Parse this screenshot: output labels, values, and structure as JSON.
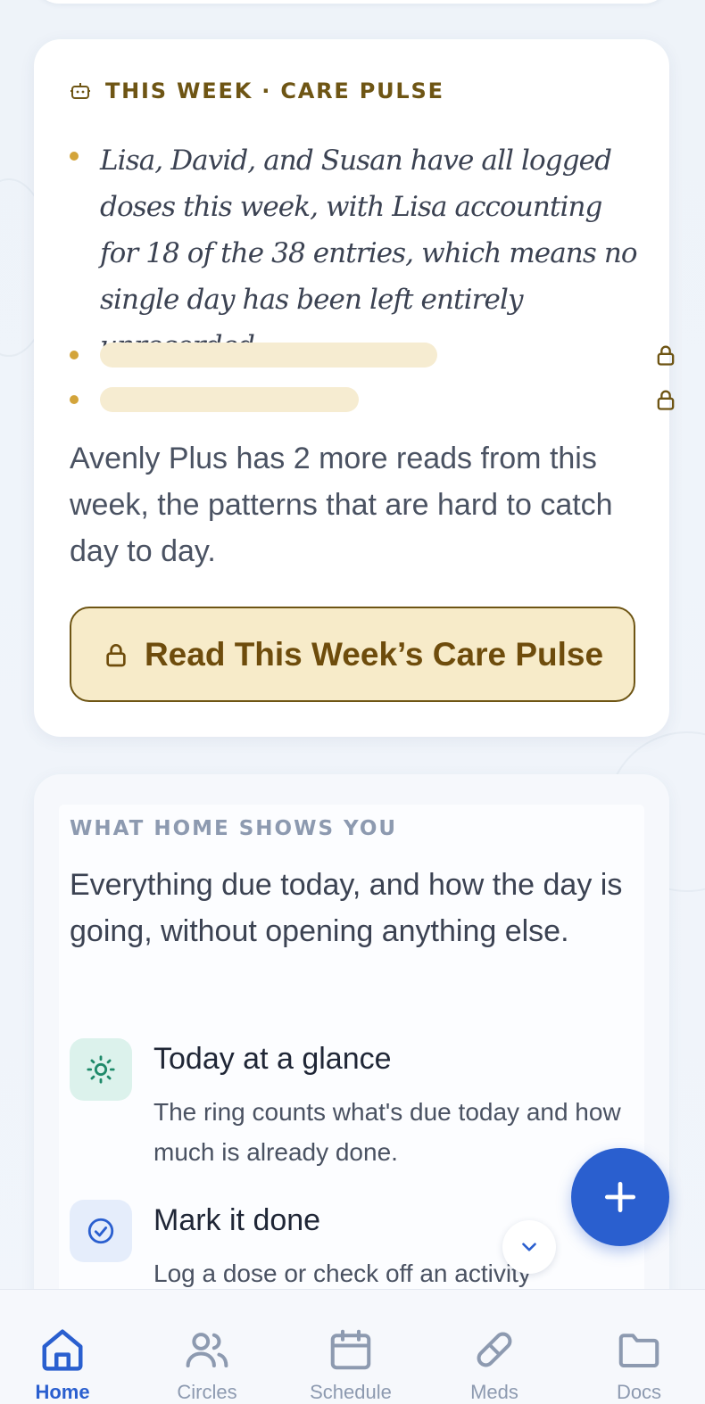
{
  "pulse": {
    "title": "THIS WEEK · CARE PULSE",
    "insight": "Lisa, David, and Susan have all logged doses this week, with Lisa accounting for 18 of the 38 entries, which means no single day has been left entirely unrecorded.",
    "upsell": "Avenly Plus has 2 more reads from this week, the patterns that are hard to catch day to day.",
    "cta_label": "Read This Week’s Care Pulse"
  },
  "home_info": {
    "eyebrow": "WHAT HOME SHOWS YOU",
    "lead": "Everything due today, and how the day is going, without opening anything else.",
    "features": [
      {
        "title": "Today at a glance",
        "desc": "The ring counts what's due today and how much is already done.",
        "icon": "sun-icon"
      },
      {
        "title": "Mark it done",
        "desc": "Log a dose or check off an activity",
        "icon": "check-circle-icon"
      }
    ]
  },
  "tabs": [
    {
      "label": "Home",
      "icon": "home-icon",
      "active": true
    },
    {
      "label": "Circles",
      "icon": "people-icon",
      "active": false
    },
    {
      "label": "Schedule",
      "icon": "calendar-icon",
      "active": false
    },
    {
      "label": "Meds",
      "icon": "pill-icon",
      "active": false
    },
    {
      "label": "Docs",
      "icon": "folder-icon",
      "active": false
    }
  ],
  "colors": {
    "brand_blue": "#2a5fcf",
    "gold": "#6e5514",
    "gold_light": "#f7ebc9"
  }
}
